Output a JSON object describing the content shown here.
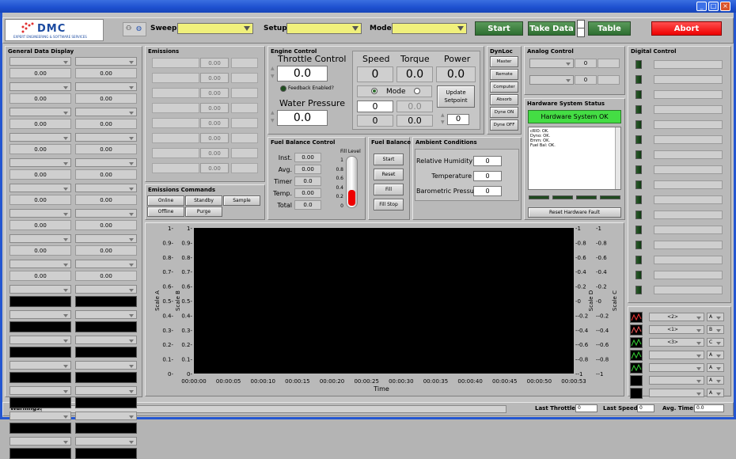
{
  "logo": {
    "name": "DMC",
    "tagline": "EXPERT ENGINEERING & SOFTWARE SERVICES"
  },
  "toolbar": {
    "sweep_label": "Sweep:",
    "setup_label": "Setup:",
    "mode_label": "Mode:",
    "start": "Start",
    "take_data": "Take Data",
    "table": "Table",
    "abort": "Abort"
  },
  "general": {
    "title": "General Data Display",
    "value": "0.00"
  },
  "emissions": {
    "title": "Emissions",
    "value": "0.00"
  },
  "emissions_cmds": {
    "title": "Emissions Commands",
    "online": "Online",
    "standby": "Standby",
    "sample": "Sample",
    "offline": "Offline",
    "purge": "Purge"
  },
  "engine": {
    "title": "Engine Control",
    "throttle_label": "Throttle Control",
    "throttle_value": "0.0",
    "feedback": "Feedback Enabled?",
    "water_label": "Water Pressure",
    "water_value": "0.0",
    "speed_label": "Speed",
    "torque_label": "Torque",
    "power_label": "Power",
    "speed": "0",
    "torque": "0.0",
    "power": "0.0",
    "mode_label": "Mode",
    "set_a": "0",
    "set_b": "0.0",
    "set_c": "0",
    "set_d": "0.0",
    "update": "Update Setpoint",
    "setpoint": "0"
  },
  "dynloc": {
    "title": "DynLoc",
    "items": [
      "Master",
      "Remote",
      "Computer",
      "Absorb",
      "Dyne ON",
      "Dyne OFF"
    ]
  },
  "analog": {
    "title": "Analog Control",
    "value": "0"
  },
  "hardware": {
    "title": "Hardware System Status",
    "status": "Hardware System OK",
    "log": [
      "cRIO: OK.",
      "Dyno: OK.",
      "Emm: OK.",
      "Fuel Bal: OK."
    ],
    "reset": "Reset Hardware Fault"
  },
  "digital": {
    "title": "Digital Control"
  },
  "fuel_control": {
    "title": "Fuel Balance Control",
    "fill_level": "Fill Level",
    "rows": [
      {
        "label": "Inst.",
        "value": "0.00"
      },
      {
        "label": "Avg.",
        "value": "0.00"
      },
      {
        "label": "Timer",
        "value": "0.0"
      },
      {
        "label": "Temp.",
        "value": "0.00"
      },
      {
        "label": "Total",
        "value": "0.0"
      }
    ],
    "ticks": [
      "1",
      "0.8",
      "0.6",
      "0.4",
      "0.2",
      "0"
    ]
  },
  "fuel_balance": {
    "title": "Fuel Balance",
    "start": "Start",
    "reset": "Reset",
    "fill": "Fill",
    "fill_stop": "Fill Stop"
  },
  "ambient": {
    "title": "Ambient Conditions",
    "rows": [
      {
        "label": "Relative Humidity",
        "value": "0"
      },
      {
        "label": "Temperature",
        "value": "0"
      },
      {
        "label": "Barometric Pressure",
        "value": "0"
      }
    ]
  },
  "chart_data": {
    "type": "line",
    "xlabel": "Time",
    "ylabels": [
      "Scale A",
      "Scale B",
      "Scale C",
      "Scale D"
    ],
    "left_ticks": [
      "1",
      "0.9",
      "0.8",
      "0.7",
      "0.6",
      "0.5",
      "0.4",
      "0.3",
      "0.2",
      "0.1",
      "0"
    ],
    "right_ticks": [
      "1",
      "0.8",
      "0.6",
      "0.4",
      "0.2",
      "0",
      "-0.2",
      "-0.4",
      "-0.6",
      "-0.8",
      "-1"
    ],
    "x_ticks": [
      "00:00:00",
      "00:00:05",
      "00:00:10",
      "00:00:15",
      "00:00:20",
      "00:00:25",
      "00:00:30",
      "00:00:35",
      "00:00:40",
      "00:00:45",
      "00:00:50",
      "00:00:53"
    ],
    "series": []
  },
  "legend_selectors": [
    {
      "label": "<2>",
      "scale": "A"
    },
    {
      "label": "<1>",
      "scale": "B"
    },
    {
      "label": "<3>",
      "scale": "C"
    },
    {
      "label": "",
      "scale": "A"
    },
    {
      "label": "",
      "scale": "A"
    },
    {
      "label": "",
      "scale": "A"
    },
    {
      "label": "",
      "scale": "A"
    }
  ],
  "status_bar": {
    "warnings": "Warnings:",
    "last_throttle": "Last Throttle:",
    "last_throttle_v": "0",
    "last_speed": "Last Speed:",
    "last_speed_v": "0",
    "avg_time": "Avg. Time:",
    "avg_time_v": "0.0"
  },
  "colors": {
    "accent_green": "#2d6e30",
    "abort_red": "#ff2020",
    "status_ok": "#44dd44"
  }
}
